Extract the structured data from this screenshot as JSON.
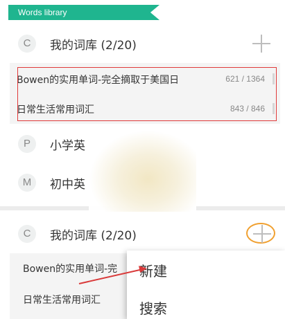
{
  "header": {
    "title": "Words library"
  },
  "libraries_top": [
    {
      "initial": "C",
      "name": "我的词库 (2/20)"
    },
    {
      "initial": "P",
      "name": "小学英"
    },
    {
      "initial": "M",
      "name": "初中英"
    }
  ],
  "words_top": [
    {
      "name": "Bowen的实用单词-完全摘取于美国日",
      "count": "621 / 1364"
    },
    {
      "name": "日常生活常用词汇",
      "count": "843 / 846"
    }
  ],
  "library_bottom": {
    "initial": "C",
    "name": "我的词库 (2/20)"
  },
  "words_bottom": [
    {
      "name": "Bowen的实用单词-完"
    },
    {
      "name": "日常生活常用词汇"
    }
  ],
  "menu": {
    "items": [
      "新建",
      "搜索"
    ]
  },
  "colors": {
    "accent": "#1fb58f",
    "highlight": "#e03a3a",
    "circle": "#f0a030"
  },
  "icons": {
    "add": "plus-icon",
    "arrow": "arrow-icon"
  }
}
